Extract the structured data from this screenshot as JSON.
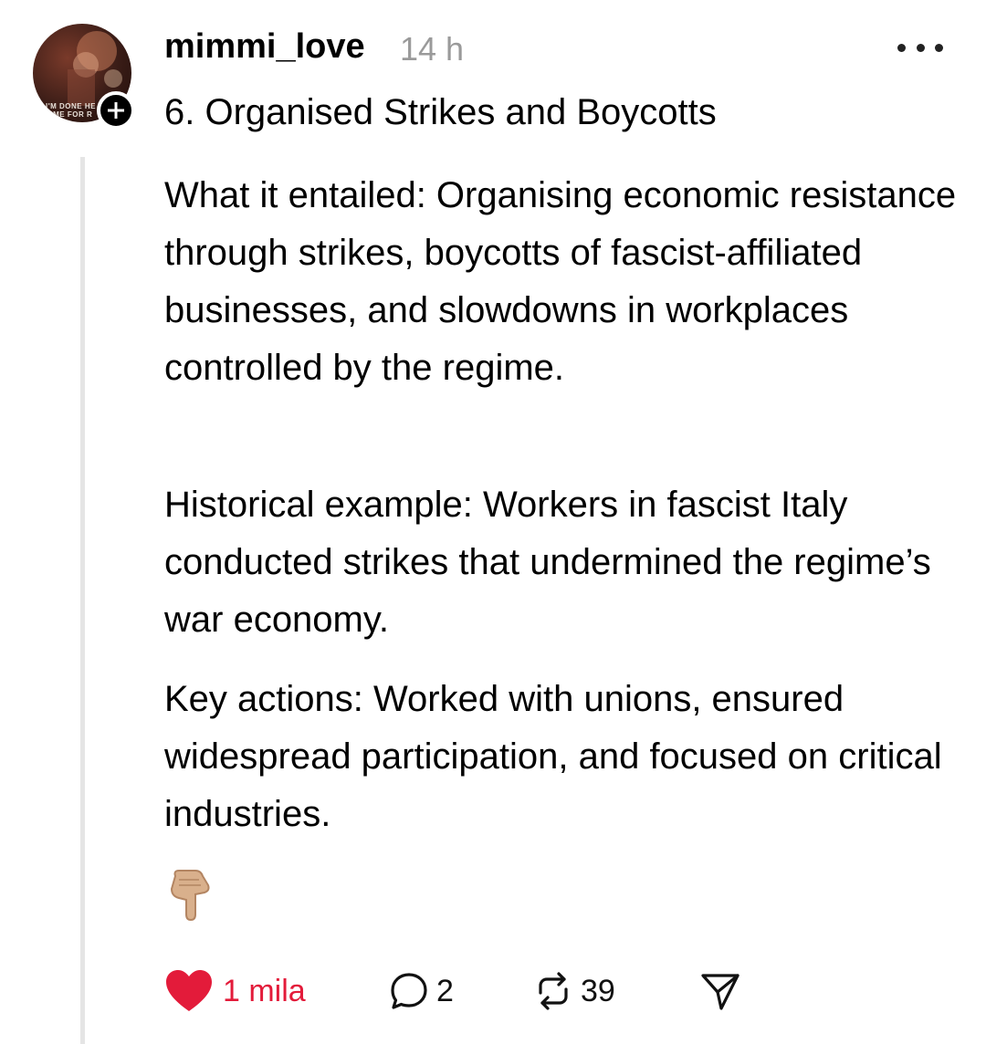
{
  "post": {
    "username": "mimmi_love",
    "time": "14 h",
    "title": "6. Organised Strikes and Boycotts",
    "paragraphs": [
      "What it entailed: Organising economic resistance through strikes, boycotts of fascist-affiliated businesses, and slowdowns in workplaces controlled by the regime.",
      "Historical example: Workers in fascist Italy conducted strikes that undermined the regime’s war economy.",
      "Key actions: Worked with unions, ensured widespread participation, and focused on critical industries."
    ],
    "emoji": "pointing-down-hand-icon"
  },
  "avatar": {
    "text": "I'M DONE HE\nTIME FOR R"
  },
  "actions": {
    "likes": "1 mila",
    "replies": "2",
    "reposts": "39"
  },
  "colors": {
    "like": "#e31b3a",
    "muted": "#9a9a9a",
    "thread_line": "#e5e5e5"
  }
}
